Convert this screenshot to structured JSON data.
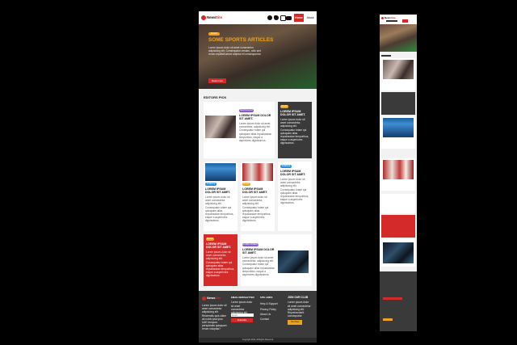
{
  "brand": {
    "name_a": "News",
    "name_b": "Site"
  },
  "nav": {
    "home": "Home",
    "about": "About"
  },
  "hero": {
    "title": "Some sports articles",
    "body": "Lorem ipsum dolor sit amet consectetur adipisicing elit. Consequatur veniam, odio sed rerum repellat labore adipisci et consequuntur.",
    "cta": "Read more"
  },
  "section": {
    "title": "Editors Pick"
  },
  "article": {
    "title": "Lorem ipsum dolor sit amet.",
    "body": "Lorem ipsum dolor sit amet consectetur, adipisicing elit. Consequatur totam qui quisquam alias repudiandae temporibus, eaque a asperiores dignissimos."
  },
  "badges": {
    "technology": "Technology",
    "sport": "Sport",
    "science": "Science",
    "entertainment": "Entertainment"
  },
  "footer": {
    "about_text": "Lorem ipsum dolor sit amet consectetur adipisicing elit. Reiciendis quis ullam ab nobis ipsa ipsa UAE tempora perspiciatis quisquam rerum voluptas?",
    "newsletter_title": "Email Newsletter",
    "newsletter_text": "Lorem ipsum dolor sit amet consectetur adipisicing elit.",
    "email_placeholder": "Email",
    "subscribe": "Subscribe",
    "links_title": "Site Links",
    "links": [
      "Help & Support",
      "Privacy Policy",
      "About Us",
      "Contact"
    ],
    "club_title": "Join Our Club",
    "club_text": "Lorem ipsum dolor sit amet consectetur adipisicing elit. Reprehenderit consequatur.",
    "join": "Join Now",
    "copyright": "Copyright 2019, All Rights Reserved"
  },
  "colors": {
    "accent": "#d52a2a",
    "technology": "#8a5cc8",
    "sport": "#f0a31a",
    "science": "#2c8fd8",
    "footer": "#3a3a3a",
    "page_bg": "#000000"
  }
}
